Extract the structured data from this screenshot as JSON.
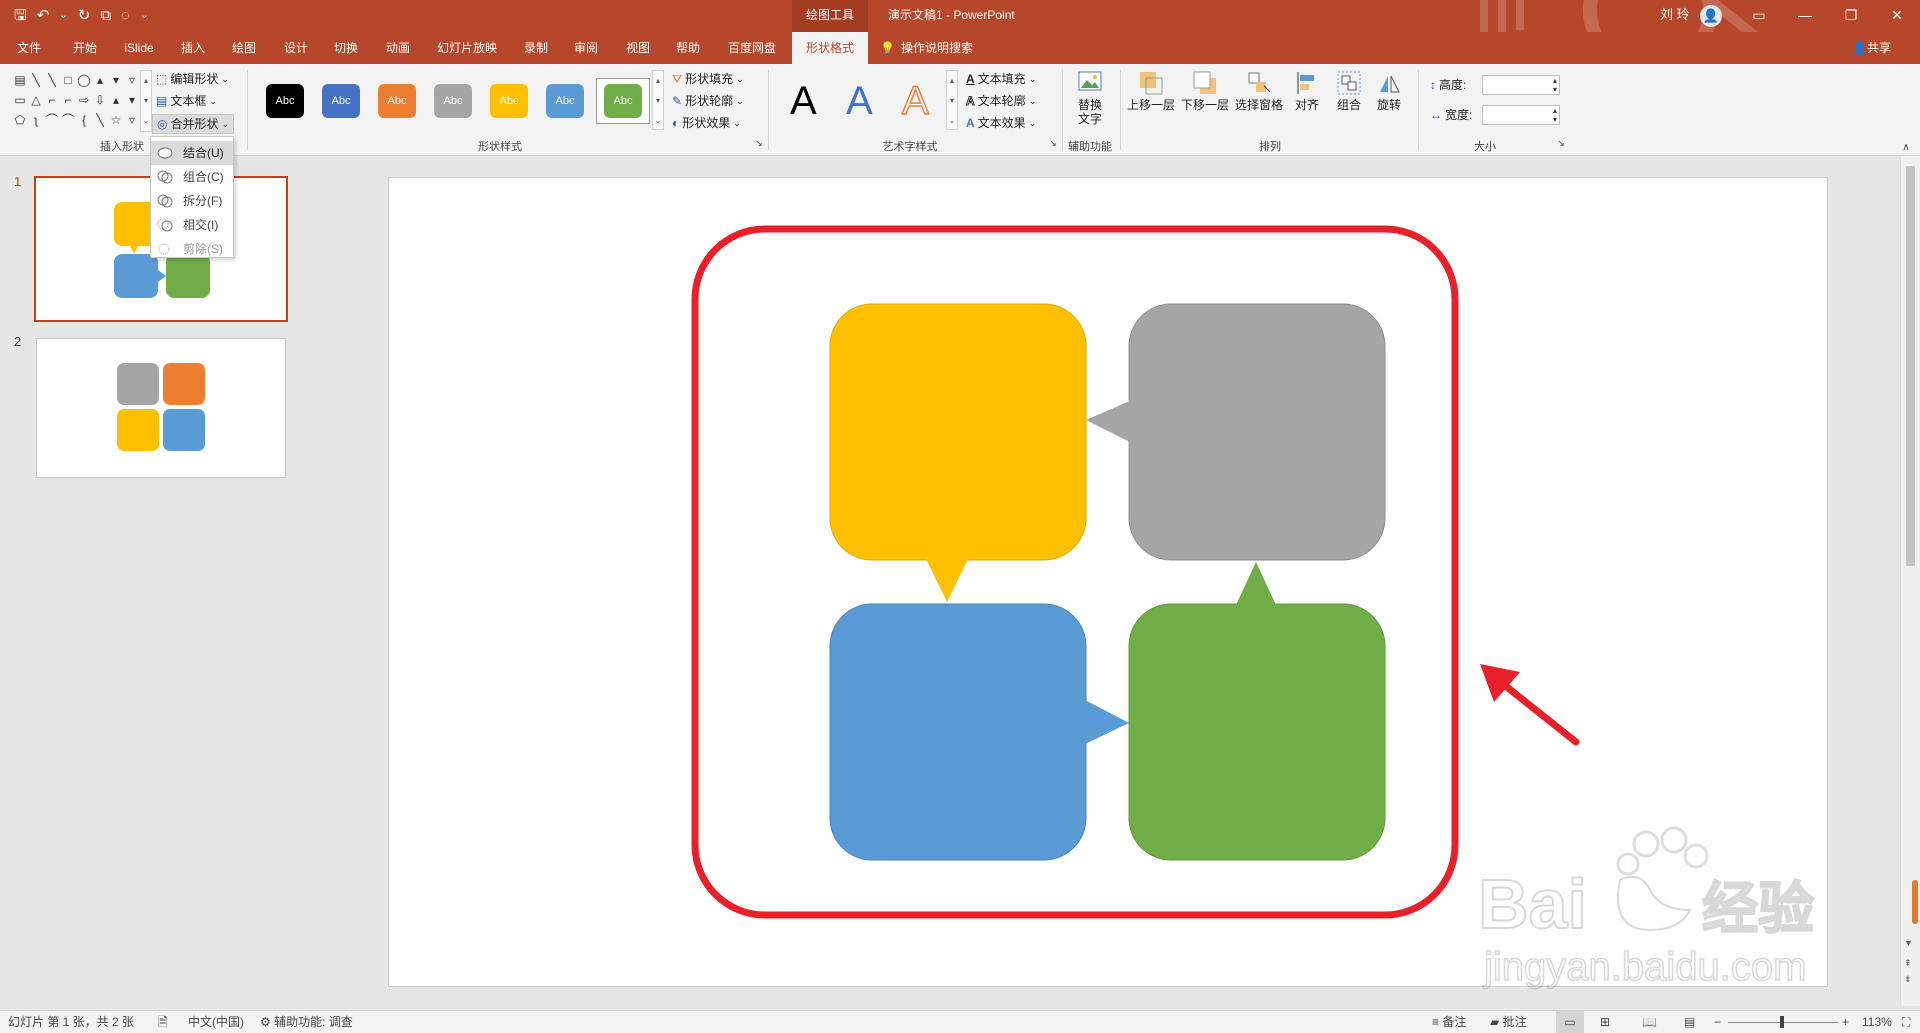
{
  "titlebar": {
    "context_tab": "绘图工具",
    "doc_title": "演示文稿1  -  PowerPoint",
    "user_name": "刘 玲",
    "avatar_glyph": "👤"
  },
  "qat": {
    "save": "🖫",
    "undo": "↶",
    "undo_menu": "⌄",
    "redo": "↻",
    "extra1": "⧉",
    "extra2": "◌",
    "customize": "⌄"
  },
  "window": {
    "ribbon_display": "▭",
    "minimize": "—",
    "restore": "❐",
    "close": "✕"
  },
  "tabs": [
    "文件",
    "开始",
    "iSlide",
    "插入",
    "绘图",
    "设计",
    "切换",
    "动画",
    "幻灯片放映",
    "录制",
    "审阅",
    "视图",
    "帮助",
    "百度网盘",
    "形状格式",
    "操作说明搜索"
  ],
  "active_tab": "形状格式",
  "share_label": "共享",
  "ribbon": {
    "insert_shapes": {
      "label": "插入形状",
      "shape_glyphs": [
        "▤",
        "╲",
        "╲",
        "□",
        "◯",
        "▴",
        "▾",
        "▿",
        "▭",
        "△",
        "⌐",
        "⌐",
        "⇨",
        "⇩",
        "▴",
        "▾",
        "⬠",
        "ʅ",
        "⌒",
        "⌒",
        "{",
        "╲",
        "☆",
        "▿"
      ],
      "edit_shape": "编辑形状",
      "textbox": "文本框",
      "merge_shapes": "合并形状"
    },
    "shape_styles": {
      "label": "形状样式",
      "swatch_text": "Abc",
      "swatches": [
        "#000000",
        "#4472c4",
        "#ed7d31",
        "#a5a5a5",
        "#ffc000",
        "#5b9bd5",
        "#70ad47"
      ],
      "fill": "形状填充",
      "outline": "形状轮廓",
      "effects": "形状效果"
    },
    "wordart": {
      "label": "艺术字样式",
      "letter": "A",
      "text_fill": "文本填充",
      "text_outline": "文本轮廓",
      "text_effects": "文本效果"
    },
    "accessibility": {
      "label": "辅助功能",
      "alt_text_l1": "替换",
      "alt_text_l2": "文字"
    },
    "arrange": {
      "label": "排列",
      "bring_forward": "上移一层",
      "send_backward": "下移一层",
      "selection_pane": "选择窗格",
      "align": "对齐",
      "group": "组合",
      "rotate": "旋转"
    },
    "size": {
      "label": "大小",
      "height": "高度:",
      "width": "宽度:",
      "height_value": "",
      "width_value": ""
    }
  },
  "merge_menu": [
    {
      "label": "结合(U)",
      "state": "highlight"
    },
    {
      "label": "组合(C)",
      "state": "normal"
    },
    {
      "label": "拆分(F)",
      "state": "normal"
    },
    {
      "label": "相交(I)",
      "state": "normal"
    },
    {
      "label": "剪除(S)",
      "state": "disabled"
    }
  ],
  "thumbnails": [
    {
      "number": "1",
      "selected": true
    },
    {
      "number": "2",
      "selected": false
    }
  ],
  "colors": {
    "yellow": "#ffc000",
    "gray": "#a5a5a5",
    "blue": "#5b9bd5",
    "green": "#70ad47",
    "orange": "#ed7d31",
    "annotation_red": "#e8202a",
    "brand": "#b7472a"
  },
  "status": {
    "slide_info": "幻灯片 第 1 张，共 2 张",
    "language": "中文(中国)",
    "accessibility": "辅助功能: 调查",
    "notes": "备注",
    "comments": "批注",
    "zoom_minus": "−",
    "zoom_plus": "+",
    "zoom": "113%"
  },
  "watermark": {
    "brand": "Bai",
    "brand_cn": "经验",
    "url": "jingyan.baidu.com"
  }
}
